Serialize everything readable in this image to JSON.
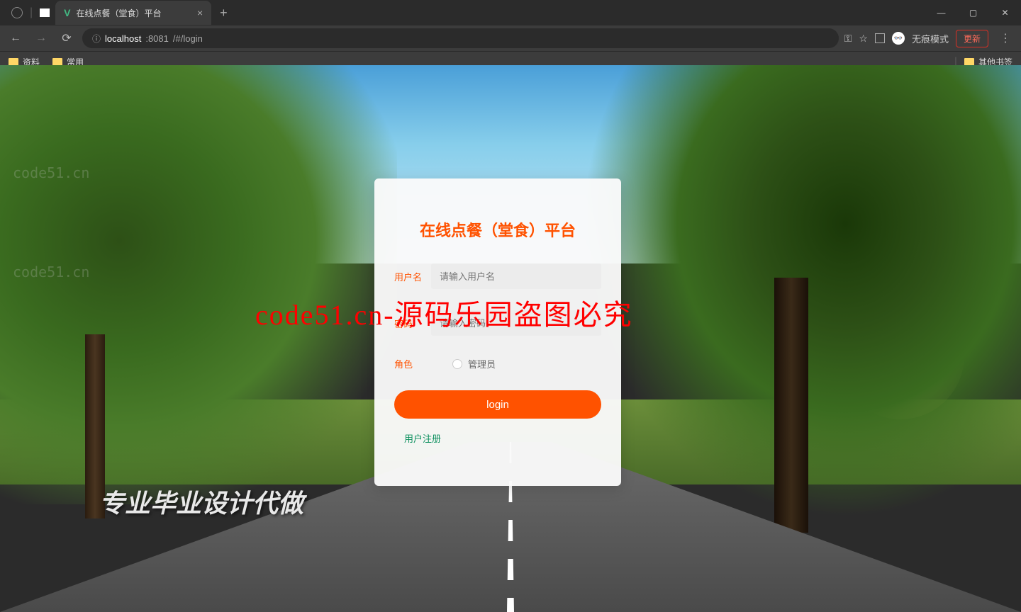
{
  "browser": {
    "tab_title": "在线点餐（堂食）平台",
    "url_scheme_icon": "ⓘ",
    "url_host": "localhost",
    "url_port": ":8081",
    "url_path": "/#/login",
    "incognito_label": "无痕模式",
    "update_label": "更新",
    "bookmarks": [
      "资料",
      "常用"
    ],
    "other_bookmarks": "其他书签"
  },
  "login": {
    "title": "在线点餐（堂食）平台",
    "username_label": "用户名",
    "username_placeholder": "请输入用户名",
    "password_label": "密码",
    "password_placeholder": "请输入密码",
    "role_label": "角色",
    "role_option": "管理员",
    "login_button": "login",
    "register_link": "用户注册"
  },
  "watermarks": {
    "center": "code51.cn-源码乐园盗图必究",
    "bottom": "专业毕业设计代做",
    "faint": "code51.cn"
  }
}
